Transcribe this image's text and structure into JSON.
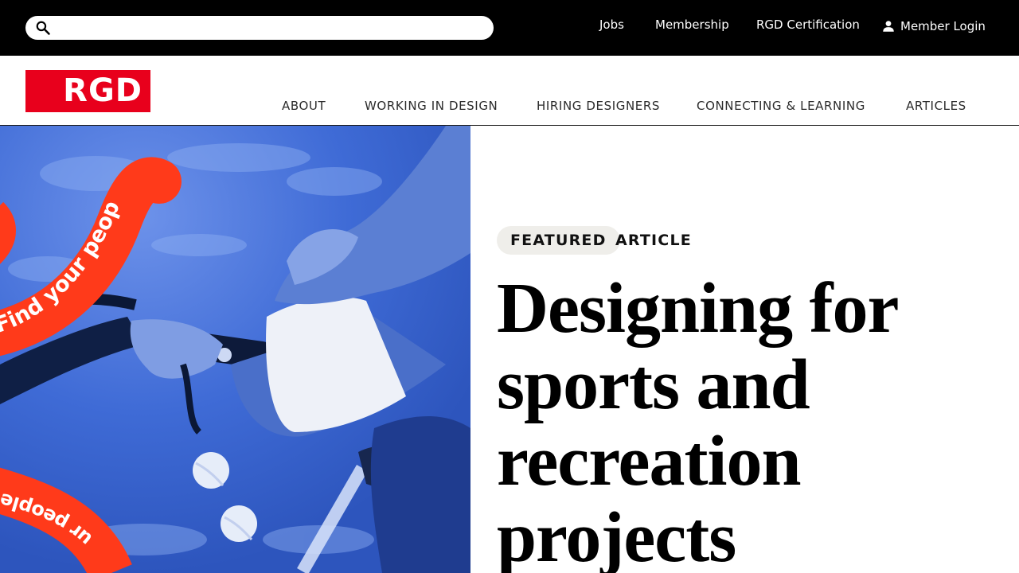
{
  "topbar": {
    "search": {
      "value": "",
      "placeholder": ""
    },
    "links": {
      "jobs": "Jobs",
      "membership": "Membership",
      "certification": "RGD Certification",
      "login": "Member Login"
    }
  },
  "header": {
    "logo_text": "RGD",
    "nav": {
      "about": "ABOUT",
      "working": "WORKING IN DESIGN",
      "hiring": "HIRING DESIGNERS",
      "connecting": "CONNECTING & LEARNING",
      "articles": "ARTICLES"
    }
  },
  "hero": {
    "pill_label": "FEATURED",
    "type_label": "ARTICLE",
    "headline_lines": [
      "Designing for",
      "sports and",
      "recreation",
      "projects"
    ],
    "ribbon_text": "Find your people.",
    "ribbon_text_lower": "ur people.Fu"
  },
  "colors": {
    "brand_red": "#e8001c",
    "ribbon_orange": "#ff3a1a",
    "photo_blue": "#3d6ad6",
    "topbar_black": "#000000"
  },
  "icons": {
    "search": "search-icon",
    "login": "person-icon"
  }
}
